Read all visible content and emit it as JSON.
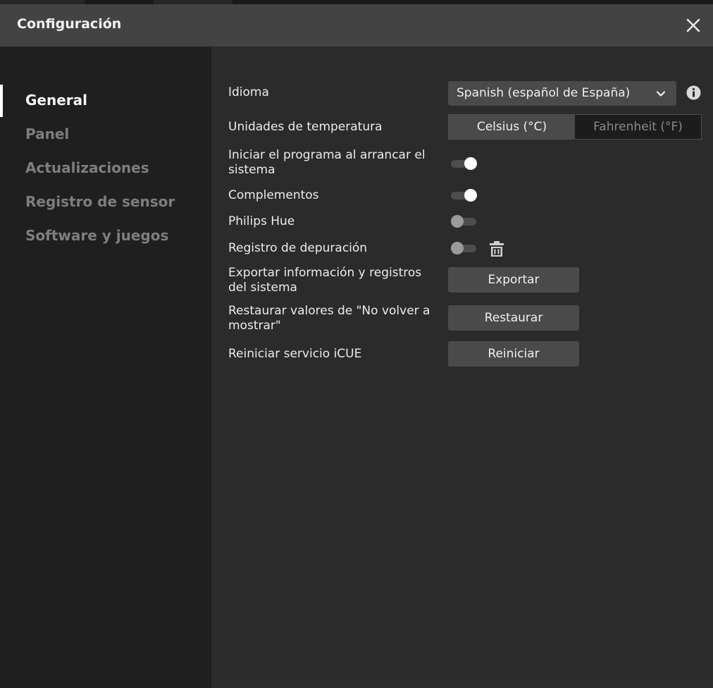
{
  "window": {
    "title": "Configuración"
  },
  "sidebar": {
    "items": [
      {
        "label": "General",
        "active": true
      },
      {
        "label": "Panel",
        "active": false
      },
      {
        "label": "Actualizaciones",
        "active": false
      },
      {
        "label": "Registro de sensor",
        "active": false
      },
      {
        "label": "Software y juegos",
        "active": false
      }
    ]
  },
  "settings": {
    "language": {
      "label": "Idioma",
      "value": "Spanish (español de España)",
      "icon": "chevron-down-icon",
      "info_icon": "info-icon"
    },
    "temperature": {
      "label": "Unidades de temperatura",
      "options": [
        "Celsius (°C)",
        "Fahrenheit (°F)"
      ],
      "selected": "Celsius (°C)"
    },
    "startup": {
      "label": "Iniciar el programa al arrancar el sistema",
      "enabled": true
    },
    "plugins": {
      "label": "Complementos",
      "enabled": true
    },
    "philips_hue": {
      "label": "Philips Hue",
      "enabled": false
    },
    "debug_log": {
      "label": "Registro de depuración",
      "enabled": false,
      "icon": "trash-icon"
    },
    "export": {
      "label": "Exportar información y registros del sistema",
      "button": "Exportar"
    },
    "restore": {
      "label": "Restaurar valores de \"No volver a mostrar\"",
      "button": "Restaurar"
    },
    "restart": {
      "label": "Reiniciar servicio iCUE",
      "button": "Reiniciar"
    }
  },
  "colors": {
    "titlebar": "#434343",
    "sidebar": "#1f1f1f",
    "content": "#2b2b2b",
    "control": "#4a4a4a",
    "accent": "#ffffff"
  }
}
